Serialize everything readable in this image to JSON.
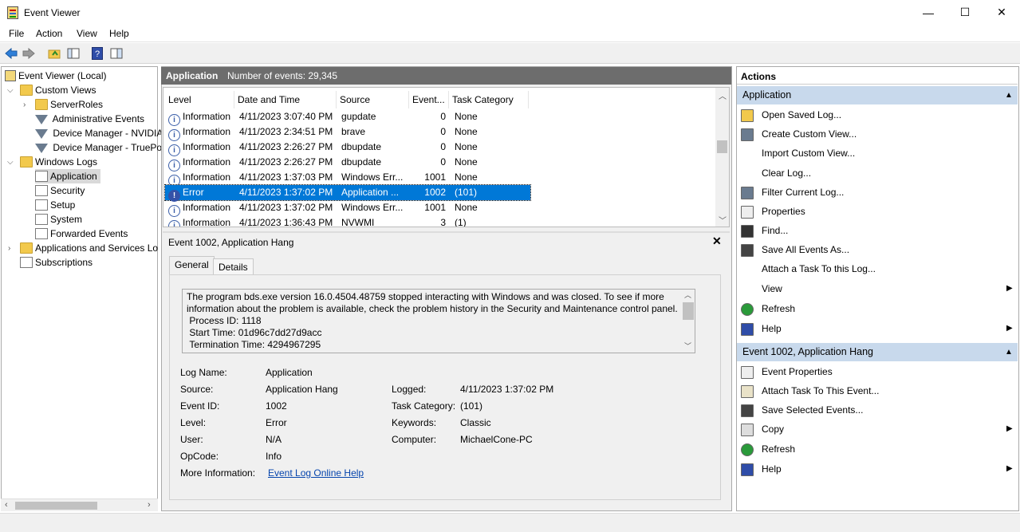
{
  "window": {
    "title": "Event Viewer",
    "minimize": "—",
    "maximize": "☐",
    "close": "✕"
  },
  "menu": [
    "File",
    "Action",
    "View",
    "Help"
  ],
  "tree": {
    "root": "Event Viewer (Local)",
    "custom_views": "Custom Views",
    "server_roles": "ServerRoles",
    "admin_events": "Administrative Events",
    "device_nvidia": "Device Manager - NVIDIA",
    "device_truepo": "Device Manager - TruePo",
    "windows_logs": "Windows Logs",
    "application": "Application",
    "security": "Security",
    "setup": "Setup",
    "system": "System",
    "forwarded": "Forwarded Events",
    "app_services": "Applications and Services Lo",
    "subscriptions": "Subscriptions"
  },
  "center": {
    "log_name": "Application",
    "count_text": "Number of events: 29,345"
  },
  "grid": {
    "headers": [
      "Level",
      "Date and Time",
      "Source",
      "Event...",
      "Task Category"
    ],
    "rows": [
      {
        "level": "Information",
        "date": "4/11/2023 3:07:40 PM",
        "source": "gupdate",
        "event": "0",
        "task": "None"
      },
      {
        "level": "Information",
        "date": "4/11/2023 2:34:51 PM",
        "source": "brave",
        "event": "0",
        "task": "None"
      },
      {
        "level": "Information",
        "date": "4/11/2023 2:26:27 PM",
        "source": "dbupdate",
        "event": "0",
        "task": "None"
      },
      {
        "level": "Information",
        "date": "4/11/2023 2:26:27 PM",
        "source": "dbupdate",
        "event": "0",
        "task": "None"
      },
      {
        "level": "Information",
        "date": "4/11/2023 1:37:03 PM",
        "source": "Windows Err...",
        "event": "1001",
        "task": "None"
      },
      {
        "level": "Error",
        "date": "4/11/2023 1:37:02 PM",
        "source": "Application ...",
        "event": "1002",
        "task": "(101)"
      },
      {
        "level": "Information",
        "date": "4/11/2023 1:37:02 PM",
        "source": "Windows Err...",
        "event": "1001",
        "task": "None"
      },
      {
        "level": "Information",
        "date": "4/11/2023 1:36:43 PM",
        "source": "NVWMI",
        "event": "3",
        "task": "(1)"
      }
    ]
  },
  "detail": {
    "title": "Event 1002, Application Hang",
    "tabs": [
      "General",
      "Details"
    ],
    "description": "The program bds.exe version 16.0.4504.48759 stopped interacting with Windows and was closed. To see if more information about the problem is available, check the problem history in the Security and Maintenance control panel.\n Process ID: 1118\n Start Time: 01d96c7dd27d9acc\n Termination Time: 4294967295",
    "labels": {
      "log_name": "Log Name:",
      "source": "Source:",
      "event_id": "Event ID:",
      "level": "Level:",
      "user": "User:",
      "opcode": "OpCode:",
      "more_info": "More Information:",
      "logged": "Logged:",
      "task_category": "Task Category:",
      "keywords": "Keywords:",
      "computer": "Computer:"
    },
    "values": {
      "log_name": "Application",
      "source": "Application Hang",
      "event_id": "1002",
      "level": "Error",
      "user": "N/A",
      "opcode": "Info",
      "more_info": "Event Log Online Help",
      "logged": "4/11/2023 1:37:02 PM",
      "task_category": "(101)",
      "keywords": "Classic",
      "computer": "MichaelCone-PC"
    }
  },
  "actions": {
    "header": "Actions",
    "section1": "Application",
    "items1": [
      "Open Saved Log...",
      "Create Custom View...",
      "Import Custom View...",
      "Clear Log...",
      "Filter Current Log...",
      "Properties",
      "Find...",
      "Save All Events As...",
      "Attach a Task To this Log...",
      "View",
      "Refresh",
      "Help"
    ],
    "section2": "Event 1002, Application Hang",
    "items2": [
      "Event Properties",
      "Attach Task To This Event...",
      "Save Selected Events...",
      "Copy",
      "Refresh",
      "Help"
    ]
  },
  "colors": {
    "selection": "#0078d7",
    "section_header": "#c8d9ec",
    "center_header": "#6d6d6d"
  }
}
